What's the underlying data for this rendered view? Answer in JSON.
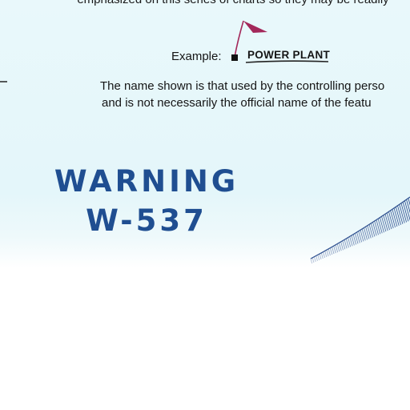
{
  "legend": {
    "top_text": "emphasized on this series of charts so they may be readily",
    "example_label": "Example:",
    "example_feature_name": "POWER PLANT",
    "note_line_1": "The name shown is that used by the controlling perso",
    "note_line_2": "and is not necessarily the official name of the featu"
  },
  "map": {
    "area_label_line_1": "WARNING",
    "area_label_line_2": "W-537",
    "area_label_color": "#1f4e91",
    "flag_color": "#a3285a",
    "boundary_color": "#2d4f8f",
    "water_tint": "#e4f6fa"
  },
  "icons": [
    "flag-icon",
    "point-symbol-icon"
  ]
}
